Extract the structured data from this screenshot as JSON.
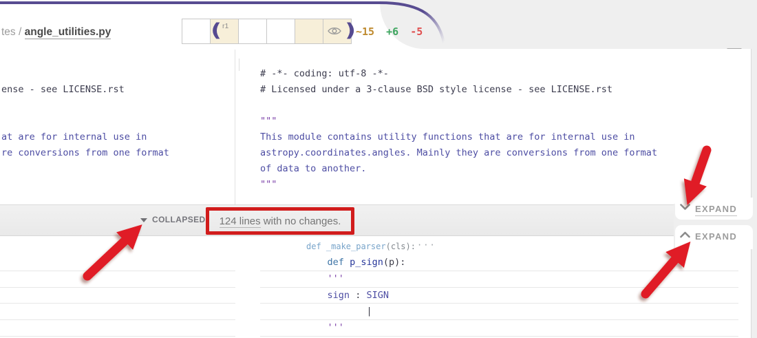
{
  "page": {
    "background_color": "#efefef",
    "accent_purple": "#584c91",
    "annotation_red": "#e01e25",
    "highlight_box_red": "#d11c1c"
  },
  "header": {
    "breadcrumb_prefix": "tes /",
    "filename": "angle_utilities.py",
    "revision_selector": {
      "revision_label": "r1",
      "cells": [
        {
          "selected": false
        },
        {
          "selected": true,
          "label": "r1",
          "marker": "open-paren"
        },
        {
          "selected": false
        },
        {
          "selected": false
        },
        {
          "selected": true
        },
        {
          "selected": true,
          "icon": "eye-icon",
          "marker": "close-paren"
        }
      ]
    },
    "stats": {
      "modified": "~15",
      "added": "+6",
      "deleted": "-5"
    }
  },
  "icons": {
    "open_paren": "(",
    "close_paren": ")",
    "eye": "eye-outline",
    "collapse_toggle": "triangle-down",
    "expand_top": "chevron-down",
    "expand_bottom": "chevron-up",
    "scroll_indicator": "triangle-down"
  },
  "collapsed_banner": {
    "label": "COLLAPSED:",
    "message_link_part": "124 lines",
    "message_rest": " with no changes."
  },
  "expand_controls": {
    "top": {
      "label": "EXPAND"
    },
    "bottom": {
      "label": "EXPAND"
    }
  },
  "diff_top": {
    "left_rows": [
      [],
      [
        {
          "c": "cm",
          "t": "ense - see LICENSE.rst"
        }
      ],
      [],
      [],
      [
        {
          "c": "doc",
          "t": "at are for internal use in"
        }
      ],
      [
        {
          "c": "doc",
          "t": "re conversions from one format"
        }
      ],
      [],
      []
    ],
    "right_rows": [
      [
        {
          "c": "cm",
          "t": "# -*- coding: utf-8 -*-"
        }
      ],
      [
        {
          "c": "cm",
          "t": "# Licensed under a 3-clause BSD style license - see LICENSE.rst"
        }
      ],
      [],
      [
        {
          "c": "q",
          "t": "\"\"\""
        }
      ],
      [
        {
          "c": "doc",
          "t": "This module contains utility functions that are for internal use in"
        }
      ],
      [
        {
          "c": "doc",
          "t": "astropy.coordinates.angles. Mainly they are conversions from one format"
        }
      ],
      [
        {
          "c": "doc",
          "t": "of data to another."
        }
      ],
      [
        {
          "c": "q",
          "t": "\"\"\""
        }
      ]
    ]
  },
  "diff_bottom": {
    "context": {
      "segments": [
        {
          "c": "ctxb",
          "t": "def _make_parser"
        },
        {
          "c": "ctxg",
          "t": "(cls):"
        }
      ],
      "ellipsis": "···"
    },
    "left_row_count": 5,
    "right_rows": [
      [
        {
          "c": "pad",
          "t": "            "
        },
        {
          "c": "kw",
          "t": "def "
        },
        {
          "c": "fn",
          "t": "p_sign"
        },
        {
          "c": "pn",
          "t": "(p):"
        }
      ],
      [
        {
          "c": "pad",
          "t": "            "
        },
        {
          "c": "q",
          "t": "'''"
        }
      ],
      [
        {
          "c": "pad",
          "t": "            "
        },
        {
          "c": "doc",
          "t": "sign"
        },
        {
          "c": "pn",
          "t": " : "
        },
        {
          "c": "doc",
          "t": "SIGN"
        }
      ],
      [
        {
          "c": "pad",
          "t": "                   "
        },
        {
          "c": "pn",
          "t": "|"
        }
      ],
      [
        {
          "c": "pad",
          "t": "            "
        },
        {
          "c": "q",
          "t": "'''"
        }
      ]
    ]
  }
}
